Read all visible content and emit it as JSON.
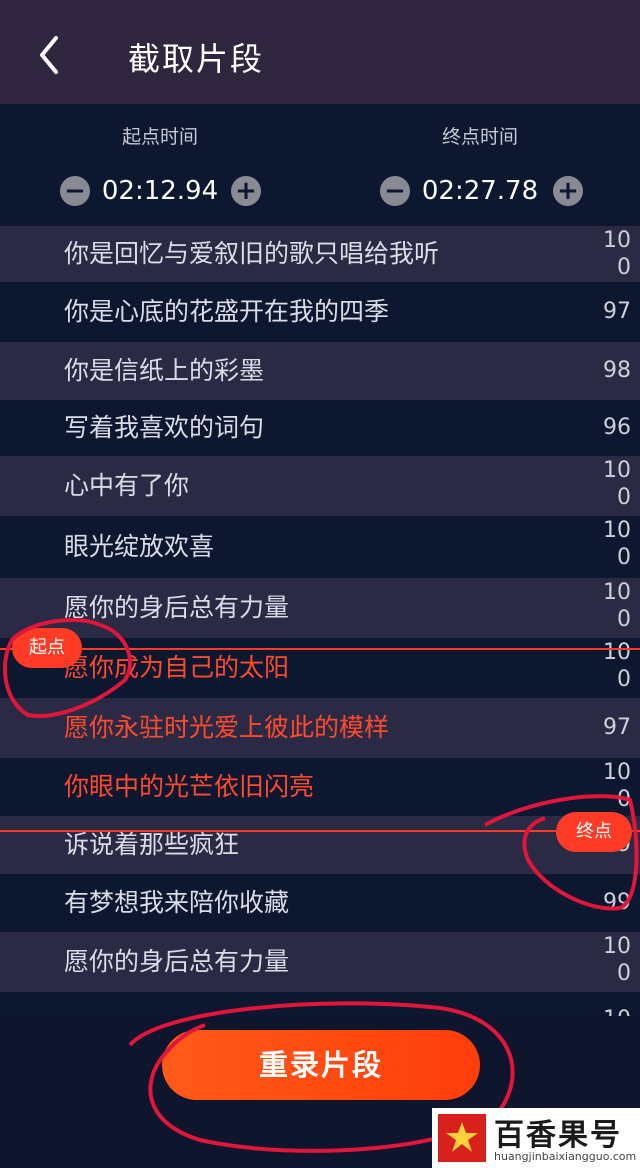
{
  "header": {
    "title": "截取片段",
    "back_icon": "chevron-left-icon"
  },
  "start": {
    "label": "起点时间",
    "value": "02:12.94"
  },
  "end": {
    "label": "终点时间",
    "value": "02:27.78"
  },
  "lyrics": [
    {
      "text": "你是回忆与爱叙旧的歌只唱给我听",
      "score": "100",
      "selected": false
    },
    {
      "text": "你是心底的花盛开在我的四季",
      "score": "97",
      "selected": false
    },
    {
      "text": "你是信纸上的彩墨",
      "score": "98",
      "selected": false
    },
    {
      "text": "写着我喜欢的词句",
      "score": "96",
      "selected": false
    },
    {
      "text": "心中有了你",
      "score": "100",
      "selected": false
    },
    {
      "text": "眼光绽放欢喜",
      "score": "100",
      "selected": false
    },
    {
      "text": "愿你的身后总有力量",
      "score": "100",
      "selected": false
    },
    {
      "text": "愿你成为自己的太阳",
      "score": "100",
      "selected": true
    },
    {
      "text": "愿你永驻时光爱上彼此的模样",
      "score": "97",
      "selected": true
    },
    {
      "text": "你眼中的光芒依旧闪亮",
      "score": "100",
      "selected": true
    },
    {
      "text": "诉说着那些疯狂",
      "score": "99",
      "selected": false
    },
    {
      "text": "有梦想我来陪你收藏",
      "score": "99",
      "selected": false
    },
    {
      "text": "愿你的身后总有力量",
      "score": "100",
      "selected": false
    },
    {
      "text": "",
      "score": "10",
      "selected": false
    }
  ],
  "markers": {
    "start_label": "起点",
    "end_label": "终点",
    "color": "#ff3b26"
  },
  "record_button": {
    "label": "重录片段"
  },
  "watermark": {
    "title": "百香果号",
    "domain": "huangjinbaixiangguo.com"
  }
}
